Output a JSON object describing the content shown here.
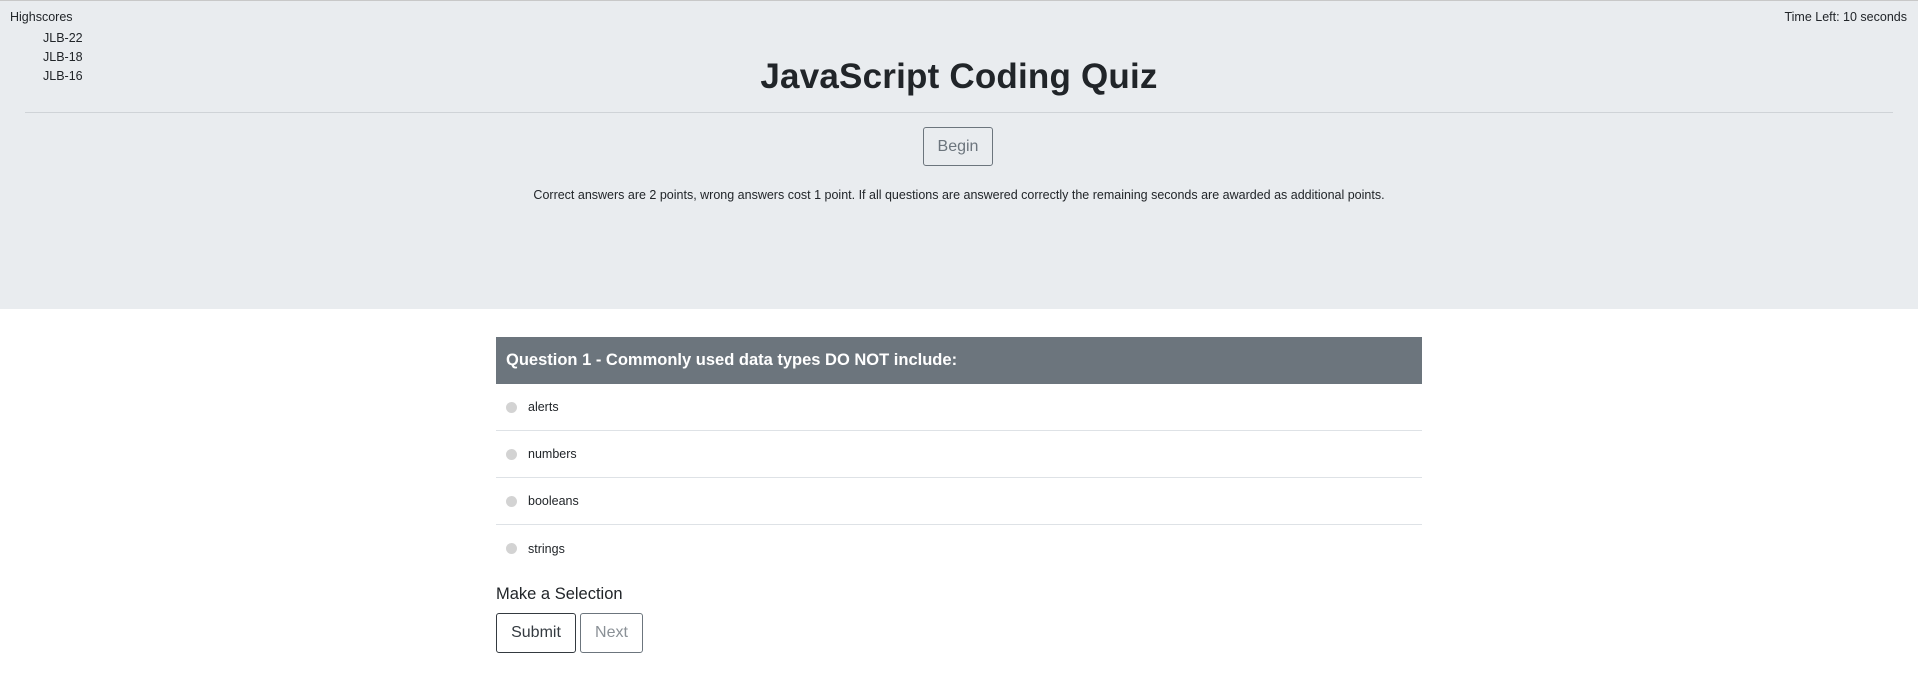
{
  "header": {
    "highscores_title": "Highscores",
    "highscores": [
      "JLB-22",
      "JLB-18",
      "JLB-16"
    ],
    "timer": "Time Left: 10 seconds",
    "title": "JavaScript Coding Quiz",
    "begin_label": "Begin",
    "rules": "Correct answers are 2 points, wrong answers cost 1 point. If all questions are answered correctly the remaining seconds are awarded as additional points."
  },
  "question": {
    "title": "Question 1 - Commonly used data types DO NOT include:",
    "answers": [
      "alerts",
      "numbers",
      "booleans",
      "strings"
    ]
  },
  "footer": {
    "selection_label": "Make a Selection",
    "submit_label": "Submit",
    "next_label": "Next"
  },
  "colors": {
    "jumbotron_bg": "#e9ecef",
    "question_header_bg": "#6c757d"
  }
}
